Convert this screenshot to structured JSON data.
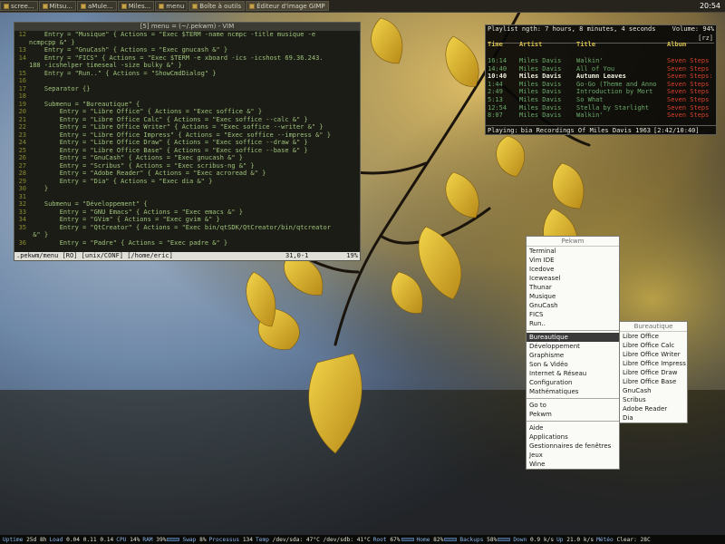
{
  "taskbar": {
    "tasks": [
      {
        "label": "scree..."
      },
      {
        "label": "Mitsu..."
      },
      {
        "label": "aMule..."
      },
      {
        "label": "Miles..."
      },
      {
        "label": "menu"
      },
      {
        "label": "Boîte à outils"
      },
      {
        "label": "Éditeur d'image GIMP"
      }
    ],
    "clock": "20:54"
  },
  "vim": {
    "title": "[5] menu = (~/.pekwm) - VIM",
    "lines": [
      {
        "n": "12",
        "t": "    Entry = \"Musique\" { Actions = \"Exec $TERM -name ncmpc -title musique -e"
      },
      {
        "n": "",
        "t": "ncmpcpp &\" }"
      },
      {
        "n": "13",
        "t": "    Entry = \"GnuCash\" { Actions = \"Exec gnucash &\" }"
      },
      {
        "n": "14",
        "t": "    Entry = \"FICS\" { Actions = \"Exec $TERM -e xboard -ics -icshost 69.36.243."
      },
      {
        "n": "",
        "t": "188 -icshelper timeseal -size bulky &\" }"
      },
      {
        "n": "15",
        "t": "    Entry = \"Run..\" { Actions = \"ShowCmdDialog\" }"
      },
      {
        "n": "16",
        "t": ""
      },
      {
        "n": "17",
        "t": "    Separator {}"
      },
      {
        "n": "18",
        "t": ""
      },
      {
        "n": "19",
        "t": "    Submenu = \"Bureautique\" {"
      },
      {
        "n": "20",
        "t": "        Entry = \"Libre Office\" { Actions = \"Exec soffice &\" }"
      },
      {
        "n": "21",
        "t": "        Entry = \"Libre Office Calc\" { Actions = \"Exec soffice --calc &\" }"
      },
      {
        "n": "22",
        "t": "        Entry = \"Libre Office Writer\" { Actions = \"Exec soffice --writer &\" }"
      },
      {
        "n": "23",
        "t": "        Entry = \"Libre Office Impress\" { Actions = \"Exec soffice --impress &\" }"
      },
      {
        "n": "24",
        "t": "        Entry = \"Libre Office Draw\" { Actions = \"Exec soffice --draw &\" }"
      },
      {
        "n": "25",
        "t": "        Entry = \"Libre Office Base\" { Actions = \"Exec soffice --base &\" }"
      },
      {
        "n": "26",
        "t": "        Entry = \"GnuCash\" { Actions = \"Exec gnucash &\" }"
      },
      {
        "n": "27",
        "t": "        Entry = \"Scribus\" { Actions = \"Exec scribus-ng &\" }"
      },
      {
        "n": "28",
        "t": "        Entry = \"Adobe Reader\" { Actions = \"Exec acroread &\" }"
      },
      {
        "n": "29",
        "t": "        Entry = \"Dia\" { Actions = \"Exec dia &\" }"
      },
      {
        "n": "30",
        "t": "    }"
      },
      {
        "n": "31",
        "t": ""
      },
      {
        "n": "32",
        "t": "    Submenu = \"Développement\" {"
      },
      {
        "n": "33",
        "t": "        Entry = \"GNU Emacs\" { Actions = \"Exec emacs &\" }"
      },
      {
        "n": "34",
        "t": "        Entry = \"GVim\" { Actions = \"Exec gvim &\" }"
      },
      {
        "n": "35",
        "t": "        Entry = \"QtCreator\" { Actions = \"Exec bin/qtSDK/QtCreator/bin/qtcreator"
      },
      {
        "n": "",
        "t": " &\" }"
      },
      {
        "n": "36",
        "t": "        Entry = \"Padre\" { Actions = \"Exec padre &\" }"
      }
    ],
    "status_left": ".pekwm/menu [RO] [unix/CONF] [/home/eric]",
    "status_pos": "31,0-1",
    "status_pct": "19%"
  },
  "playlist": {
    "header": "Playlist ngth: 7 hours, 8 minutes, 4 seconds",
    "volume": "Volume: 94%",
    "rz": "[rz]",
    "columns": {
      "time": "Time",
      "artist": "Artist",
      "title": "Title",
      "album": "Album"
    },
    "rows": [
      {
        "time": "16:14",
        "artist": "Miles Davis",
        "title": "Walkin'",
        "album": "Seven Steps"
      },
      {
        "time": "14:40",
        "artist": "Miles Davis",
        "title": "All of You",
        "album": "Seven Steps"
      },
      {
        "time": "10:40",
        "artist": "Miles Davis",
        "title": "Autumn Leaves",
        "album": "Seven Steps:"
      },
      {
        "time": "1:44",
        "artist": "Miles Davis",
        "title": "Go-Go (Theme and Anno",
        "album": "Seven Steps"
      },
      {
        "time": "2:49",
        "artist": "Miles Davis",
        "title": "Introduction by Mort",
        "album": "Seven Steps"
      },
      {
        "time": "5:13",
        "artist": "Miles Davis",
        "title": "So What",
        "album": "Seven Steps"
      },
      {
        "time": "12:54",
        "artist": "Miles Davis",
        "title": "Stella by Starlight",
        "album": "Seven Steps"
      },
      {
        "time": "8:07",
        "artist": "Miles Davis",
        "title": "Walkin'",
        "album": "Seven Steps"
      }
    ],
    "current_index": 2,
    "playing_label": "Playing:",
    "playing_text": "bia Recordings Of Miles Davis 1963",
    "playing_time": "[2:42/10:40]"
  },
  "menu_main": {
    "title": "Pekwm",
    "groups": [
      [
        "Terminal",
        "Vim IDE",
        "Icedove",
        "Iceweasel",
        "Thunar",
        "Musique",
        "GnuCash",
        "FICS",
        "Run.."
      ],
      [
        "Bureautique",
        "Développement",
        "Graphisme",
        "Son & Vidéo",
        "Internet & Réseau",
        "Configuration",
        "Mathématiques"
      ],
      [
        "Go to",
        "Pekwm"
      ],
      [
        "Aide",
        "Applications",
        "Gestionnaires de fenêtres",
        "Jeux",
        "Wine"
      ]
    ],
    "selected": "Bureautique"
  },
  "menu_sub": {
    "title": "Bureautique",
    "items": [
      "Libre Office",
      "Libre Office Calc",
      "Libre Office Writer",
      "Libre Office Impress",
      "Libre Office Draw",
      "Libre Office Base",
      "GnuCash",
      "Scribus",
      "Adobe Reader",
      "Dia"
    ]
  },
  "conky": {
    "uptime_label": "Uptime",
    "uptime": "25d 8h",
    "load_label": "Load",
    "load": "0.04 0.11 0.14",
    "cpu_label": "CPU",
    "cpu": "14%",
    "ram_label": "RAM",
    "ram": "39%",
    "swap_label": "Swap",
    "swap": "8%",
    "proc_label": "Processus",
    "proc": "134",
    "temp_label": "Temp",
    "temp": "/dev/sda: 47°C /dev/sdb: 41°C",
    "root_label": "Root",
    "root": "67%",
    "home_label": "Home",
    "home": "82%",
    "backups_label": "Backups",
    "backups": "58%",
    "down_label": "Down",
    "down": "0.9 k/s",
    "up_label": "Up",
    "up": "21.0 k/s",
    "meteo_label": "Météo",
    "meteo": "Clear: 28C"
  },
  "colors": {
    "accent": "#3a3a3a",
    "vim_text": "#9ec27a",
    "album_red": "#d8402a",
    "playlist_green": "#6aaa6a"
  }
}
